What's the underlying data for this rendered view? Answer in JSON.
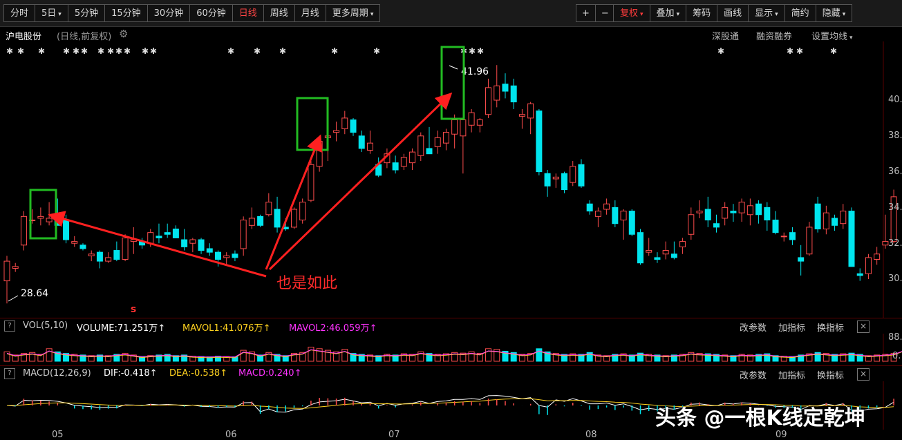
{
  "toolbar": {
    "periods": [
      {
        "label": "分时",
        "caret": false,
        "active": false
      },
      {
        "label": "5日",
        "caret": true,
        "active": false
      },
      {
        "label": "5分钟",
        "caret": false,
        "active": false
      },
      {
        "label": "15分钟",
        "caret": false,
        "active": false
      },
      {
        "label": "30分钟",
        "caret": false,
        "active": false
      },
      {
        "label": "60分钟",
        "caret": false,
        "active": false
      },
      {
        "label": "日线",
        "caret": false,
        "active": true
      },
      {
        "label": "周线",
        "caret": false,
        "active": false
      },
      {
        "label": "月线",
        "caret": false,
        "active": false
      },
      {
        "label": "更多周期",
        "caret": true,
        "active": false
      }
    ],
    "zoom_in": "+",
    "zoom_out": "−",
    "tools": [
      {
        "label": "复权",
        "caret": true,
        "red": true
      },
      {
        "label": "叠加",
        "caret": true,
        "red": false
      },
      {
        "label": "筹码",
        "caret": false,
        "red": false
      },
      {
        "label": "画线",
        "caret": false,
        "red": false
      },
      {
        "label": "显示",
        "caret": true,
        "red": false
      },
      {
        "label": "简约",
        "caret": false,
        "red": false
      },
      {
        "label": "隐藏",
        "caret": true,
        "red": false
      }
    ]
  },
  "info": {
    "stock_name": "沪电股份",
    "sub": "(日线,前复权)",
    "links": [
      "深股通",
      "融资融券",
      "设置均线"
    ]
  },
  "vol_bar": {
    "q": "?",
    "title": "VOL(5,10)",
    "volume": "VOLUME:71.251万",
    "mavol1": "MAVOL1:41.076万",
    "mavol2": "MAVOL2:46.059万",
    "actions": [
      "改参数",
      "加指标",
      "换指标"
    ],
    "close": "×"
  },
  "macd_bar": {
    "q": "?",
    "title": "MACD(12,26,9)",
    "dif": "DIF:-0.418",
    "dea": "DEA:-0.538",
    "macd": "MACD:0.240",
    "actions": [
      "改参数",
      "加指标",
      "换指标"
    ],
    "close": "×"
  },
  "price_axis": [
    "40.",
    "38.",
    "36.",
    "34.",
    "32.",
    "30."
  ],
  "vol_axis": [
    "88.",
    "0."
  ],
  "date_axis": [
    "05",
    "06",
    "07",
    "08",
    "09"
  ],
  "annotations": {
    "high_label": "41.96",
    "low_label": "28.64",
    "note": "也是如此"
  },
  "watermark": "头条 @一根K线定乾坤",
  "colors": {
    "up": "#ff4d4d",
    "down": "#00e5ee",
    "green_box": "#22bb22",
    "arrow": "#ff2020",
    "mavol1": "#ffd21f",
    "mavol2": "#ff33ff"
  },
  "chart_data": {
    "type": "candlestick",
    "title": "",
    "xlabel": "",
    "ylabel": "",
    "ylim": [
      28.64,
      41.96
    ],
    "x_ticks": [
      "05",
      "06",
      "07",
      "08",
      "09"
    ],
    "candles": [
      {
        "o": 29.9,
        "h": 31.3,
        "l": 28.64,
        "c": 31.0
      },
      {
        "o": 30.6,
        "h": 30.9,
        "l": 30.4,
        "c": 30.7
      },
      {
        "o": 31.9,
        "h": 33.8,
        "l": 31.6,
        "c": 33.5
      },
      {
        "o": 33.3,
        "h": 33.9,
        "l": 33.1,
        "c": 33.3
      },
      {
        "o": 33.4,
        "h": 34.0,
        "l": 33.0,
        "c": 33.5
      },
      {
        "o": 33.2,
        "h": 34.3,
        "l": 33.0,
        "c": 33.4
      },
      {
        "o": 33.6,
        "h": 34.5,
        "l": 33.3,
        "c": 33.0
      },
      {
        "o": 33.3,
        "h": 33.6,
        "l": 32.0,
        "c": 32.2
      },
      {
        "o": 32.0,
        "h": 32.4,
        "l": 31.8,
        "c": 32.1
      },
      {
        "o": 31.9,
        "h": 32.0,
        "l": 31.6,
        "c": 31.7
      },
      {
        "o": 31.3,
        "h": 31.6,
        "l": 31.0,
        "c": 31.4
      },
      {
        "o": 31.5,
        "h": 31.6,
        "l": 30.6,
        "c": 31.0
      },
      {
        "o": 31.0,
        "h": 31.5,
        "l": 30.9,
        "c": 31.2
      },
      {
        "o": 31.6,
        "h": 32.1,
        "l": 31.0,
        "c": 31.1
      },
      {
        "o": 31.1,
        "h": 32.5,
        "l": 31.0,
        "c": 32.3
      },
      {
        "o": 32.1,
        "h": 32.9,
        "l": 31.4,
        "c": 32.2
      },
      {
        "o": 32.1,
        "h": 32.3,
        "l": 31.7,
        "c": 31.9
      },
      {
        "o": 32.0,
        "h": 32.8,
        "l": 31.8,
        "c": 32.6
      },
      {
        "o": 32.4,
        "h": 33.1,
        "l": 32.0,
        "c": 32.3
      },
      {
        "o": 32.6,
        "h": 33.1,
        "l": 32.3,
        "c": 32.5
      },
      {
        "o": 32.8,
        "h": 33.0,
        "l": 32.3,
        "c": 32.3
      },
      {
        "o": 32.2,
        "h": 32.8,
        "l": 31.6,
        "c": 31.8
      },
      {
        "o": 32.0,
        "h": 32.3,
        "l": 31.5,
        "c": 32.2
      },
      {
        "o": 32.2,
        "h": 32.3,
        "l": 31.4,
        "c": 31.6
      },
      {
        "o": 31.7,
        "h": 32.0,
        "l": 31.3,
        "c": 31.5
      },
      {
        "o": 31.5,
        "h": 31.6,
        "l": 30.7,
        "c": 31.1
      },
      {
        "o": 31.2,
        "h": 31.5,
        "l": 30.8,
        "c": 31.3
      },
      {
        "o": 31.4,
        "h": 31.6,
        "l": 31.0,
        "c": 31.2
      },
      {
        "o": 31.7,
        "h": 33.5,
        "l": 31.3,
        "c": 33.3
      },
      {
        "o": 33.0,
        "h": 34.0,
        "l": 32.8,
        "c": 33.4
      },
      {
        "o": 33.5,
        "h": 33.6,
        "l": 32.9,
        "c": 33.0
      },
      {
        "o": 33.6,
        "h": 34.8,
        "l": 33.5,
        "c": 34.3
      },
      {
        "o": 33.9,
        "h": 34.6,
        "l": 32.6,
        "c": 32.9
      },
      {
        "o": 32.9,
        "h": 33.4,
        "l": 32.7,
        "c": 32.8
      },
      {
        "o": 32.9,
        "h": 34.0,
        "l": 32.8,
        "c": 33.9
      },
      {
        "o": 33.3,
        "h": 34.5,
        "l": 33.1,
        "c": 34.3
      },
      {
        "o": 34.4,
        "h": 36.6,
        "l": 34.3,
        "c": 36.4
      },
      {
        "o": 36.3,
        "h": 37.9,
        "l": 36.0,
        "c": 37.7
      },
      {
        "o": 37.9,
        "h": 38.3,
        "l": 36.6,
        "c": 38.0
      },
      {
        "o": 38.2,
        "h": 38.8,
        "l": 37.7,
        "c": 38.3
      },
      {
        "o": 38.4,
        "h": 39.4,
        "l": 38.1,
        "c": 39.0
      },
      {
        "o": 38.9,
        "h": 39.0,
        "l": 38.0,
        "c": 38.2
      },
      {
        "o": 38.0,
        "h": 38.3,
        "l": 37.1,
        "c": 37.3
      },
      {
        "o": 37.2,
        "h": 38.3,
        "l": 37.0,
        "c": 37.6
      },
      {
        "o": 36.4,
        "h": 36.8,
        "l": 35.7,
        "c": 35.8
      },
      {
        "o": 36.5,
        "h": 37.3,
        "l": 36.2,
        "c": 37.0
      },
      {
        "o": 36.5,
        "h": 36.9,
        "l": 35.9,
        "c": 36.1
      },
      {
        "o": 36.3,
        "h": 37.0,
        "l": 36.1,
        "c": 36.8
      },
      {
        "o": 36.5,
        "h": 37.3,
        "l": 36.1,
        "c": 37.1
      },
      {
        "o": 36.9,
        "h": 38.2,
        "l": 36.6,
        "c": 38.0
      },
      {
        "o": 37.3,
        "h": 38.5,
        "l": 37.0,
        "c": 37.0
      },
      {
        "o": 37.4,
        "h": 38.3,
        "l": 37.0,
        "c": 37.9
      },
      {
        "o": 37.6,
        "h": 38.4,
        "l": 37.2,
        "c": 38.2
      },
      {
        "o": 38.1,
        "h": 39.2,
        "l": 37.3,
        "c": 38.9
      },
      {
        "o": 38.0,
        "h": 38.9,
        "l": 35.9,
        "c": 38.9
      },
      {
        "o": 38.6,
        "h": 39.5,
        "l": 38.2,
        "c": 39.3
      },
      {
        "o": 38.6,
        "h": 39.0,
        "l": 38.2,
        "c": 38.9
      },
      {
        "o": 39.2,
        "h": 41.2,
        "l": 39.0,
        "c": 40.7
      },
      {
        "o": 40.0,
        "h": 41.96,
        "l": 39.6,
        "c": 40.8
      },
      {
        "o": 40.9,
        "h": 41.5,
        "l": 40.1,
        "c": 40.5
      },
      {
        "o": 40.8,
        "h": 41.2,
        "l": 39.5,
        "c": 39.9
      },
      {
        "o": 39.1,
        "h": 39.5,
        "l": 38.4,
        "c": 39.2
      },
      {
        "o": 39.0,
        "h": 39.9,
        "l": 38.1,
        "c": 39.8
      },
      {
        "o": 39.4,
        "h": 39.5,
        "l": 35.8,
        "c": 36.0
      },
      {
        "o": 35.9,
        "h": 36.1,
        "l": 34.6,
        "c": 35.2
      },
      {
        "o": 35.6,
        "h": 35.9,
        "l": 35.1,
        "c": 35.7
      },
      {
        "o": 35.9,
        "h": 36.0,
        "l": 34.8,
        "c": 35.0
      },
      {
        "o": 35.4,
        "h": 36.6,
        "l": 35.2,
        "c": 36.3
      },
      {
        "o": 36.4,
        "h": 36.7,
        "l": 35.1,
        "c": 35.2
      },
      {
        "o": 34.2,
        "h": 34.4,
        "l": 33.6,
        "c": 33.8
      },
      {
        "o": 33.5,
        "h": 34.0,
        "l": 32.9,
        "c": 33.8
      },
      {
        "o": 33.9,
        "h": 34.5,
        "l": 33.6,
        "c": 34.2
      },
      {
        "o": 34.0,
        "h": 34.4,
        "l": 32.9,
        "c": 33.1
      },
      {
        "o": 33.3,
        "h": 33.9,
        "l": 32.2,
        "c": 33.8
      },
      {
        "o": 33.8,
        "h": 33.9,
        "l": 32.4,
        "c": 32.5
      },
      {
        "o": 32.6,
        "h": 32.8,
        "l": 30.8,
        "c": 30.9
      },
      {
        "o": 31.5,
        "h": 32.3,
        "l": 31.3,
        "c": 31.6
      },
      {
        "o": 31.2,
        "h": 31.5,
        "l": 30.9,
        "c": 31.1
      },
      {
        "o": 31.4,
        "h": 32.1,
        "l": 31.1,
        "c": 31.6
      },
      {
        "o": 31.4,
        "h": 32.1,
        "l": 31.1,
        "c": 31.2
      },
      {
        "o": 31.8,
        "h": 32.3,
        "l": 31.4,
        "c": 32.1
      },
      {
        "o": 32.5,
        "h": 34.0,
        "l": 32.2,
        "c": 33.6
      },
      {
        "o": 33.7,
        "h": 34.4,
        "l": 33.4,
        "c": 33.8
      },
      {
        "o": 33.9,
        "h": 34.6,
        "l": 32.9,
        "c": 33.3
      },
      {
        "o": 33.1,
        "h": 33.6,
        "l": 32.6,
        "c": 32.9
      },
      {
        "o": 33.4,
        "h": 34.3,
        "l": 33.0,
        "c": 34.0
      },
      {
        "o": 33.8,
        "h": 34.2,
        "l": 33.2,
        "c": 33.7
      },
      {
        "o": 33.7,
        "h": 34.5,
        "l": 33.2,
        "c": 34.3
      },
      {
        "o": 33.6,
        "h": 34.5,
        "l": 33.0,
        "c": 34.1
      },
      {
        "o": 34.2,
        "h": 34.4,
        "l": 33.1,
        "c": 33.6
      },
      {
        "o": 34.0,
        "h": 34.3,
        "l": 32.7,
        "c": 33.3
      },
      {
        "o": 33.3,
        "h": 33.8,
        "l": 32.5,
        "c": 32.6
      },
      {
        "o": 32.4,
        "h": 32.6,
        "l": 32.1,
        "c": 32.4
      },
      {
        "o": 32.6,
        "h": 32.9,
        "l": 31.9,
        "c": 32.2
      },
      {
        "o": 31.2,
        "h": 31.9,
        "l": 30.2,
        "c": 31.0
      },
      {
        "o": 31.4,
        "h": 33.2,
        "l": 31.3,
        "c": 32.9
      },
      {
        "o": 34.2,
        "h": 34.6,
        "l": 32.6,
        "c": 32.8
      },
      {
        "o": 32.8,
        "h": 34.1,
        "l": 32.5,
        "c": 33.7
      },
      {
        "o": 33.4,
        "h": 33.6,
        "l": 32.7,
        "c": 33.0
      },
      {
        "o": 33.1,
        "h": 34.2,
        "l": 32.8,
        "c": 33.8
      },
      {
        "o": 33.8,
        "h": 34.0,
        "l": 30.7,
        "c": 30.7
      },
      {
        "o": 30.3,
        "h": 30.6,
        "l": 29.9,
        "c": 30.2
      },
      {
        "o": 30.3,
        "h": 31.4,
        "l": 30.0,
        "c": 31.2
      },
      {
        "o": 31.1,
        "h": 31.8,
        "l": 30.8,
        "c": 31.4
      },
      {
        "o": 31.9,
        "h": 33.6,
        "l": 31.7,
        "c": 32.1
      },
      {
        "o": 32.1,
        "h": 35.0,
        "l": 32.0,
        "c": 34.6
      }
    ],
    "volume_ylim": [
      0,
      88
    ]
  }
}
